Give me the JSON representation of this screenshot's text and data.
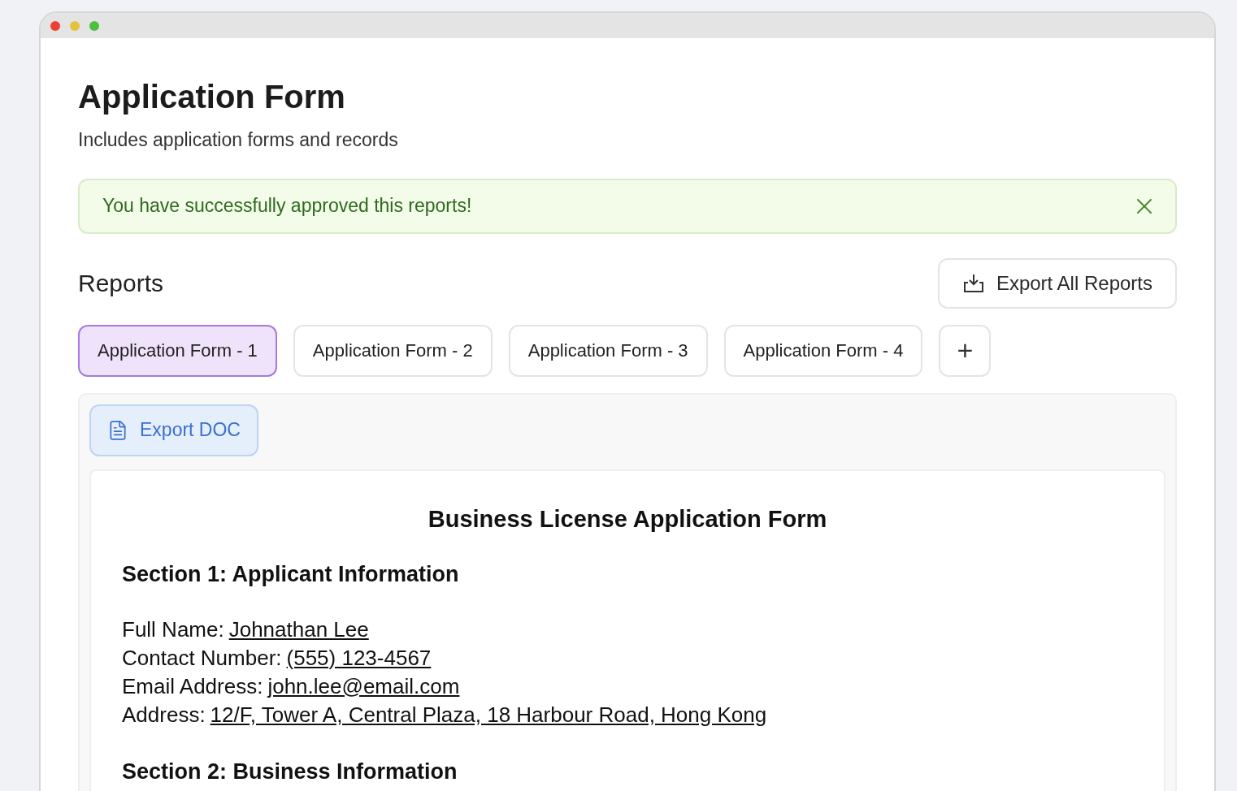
{
  "page": {
    "title": "Application Form",
    "subtitle": "Includes application forms and records"
  },
  "alert": {
    "message": "You have successfully approved this reports!"
  },
  "reports": {
    "heading": "Reports",
    "export_all": "Export All Reports",
    "tabs": [
      {
        "label": "Application Form - 1",
        "selected": true
      },
      {
        "label": "Application Form - 2",
        "selected": false
      },
      {
        "label": "Application Form - 3",
        "selected": false
      },
      {
        "label": "Application Form - 4",
        "selected": false
      }
    ],
    "add_tab": "+"
  },
  "document": {
    "export_button": "Export DOC",
    "title": "Business License Application Form",
    "sections": [
      {
        "heading": "Section 1: Applicant Information",
        "fields": [
          {
            "label": "Full Name:",
            "value": "Johnathan Lee"
          },
          {
            "label": "Contact Number:",
            "value": "(555) 123-4567"
          },
          {
            "label": "Email Address:",
            "value": "john.lee@email.com"
          },
          {
            "label": "Address:",
            "value": "12/F, Tower A, Central Plaza, 18 Harbour Road, Hong Kong"
          }
        ]
      },
      {
        "heading": "Section 2: Business Information"
      }
    ]
  }
}
